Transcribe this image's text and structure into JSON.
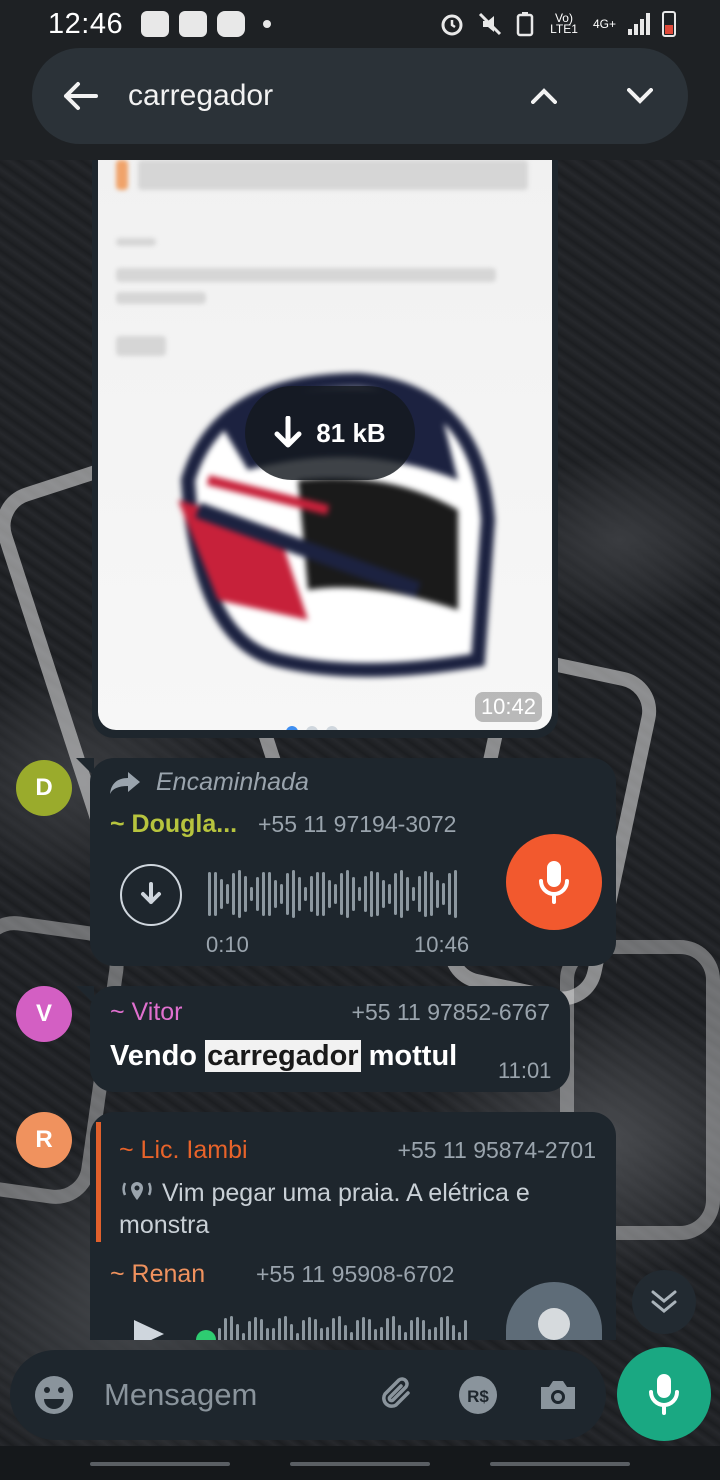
{
  "status_bar": {
    "time": "12:46",
    "network_label": "Vo) LTE1",
    "network_type": "4G+",
    "icons": [
      "twitch-icon",
      "twitch-icon",
      "youtube-icon",
      "alarm-icon",
      "mute-icon",
      "battery-saver-icon",
      "signal-icon",
      "battery-icon"
    ]
  },
  "search": {
    "query": "carregador"
  },
  "photo_message": {
    "download_size": "81 kB",
    "time": "10:42"
  },
  "messages": [
    {
      "avatar_letter": "D",
      "avatar_color": "#9aab2c",
      "forwarded_label": "Encaminhada",
      "sender": "~ Dougla...",
      "sender_color": "#b7c43e",
      "phone": "+55 11 97194-3072",
      "voice_duration": "0:10",
      "time": "10:46"
    },
    {
      "avatar_letter": "V",
      "avatar_color": "#d35fc3",
      "sender": "~ Vitor",
      "sender_color": "#e070cf",
      "phone": "+55 11 97852-6767",
      "text_before": "Vendo ",
      "text_highlight": "carregador",
      "text_after": " mottul",
      "time": "11:01"
    },
    {
      "avatar_letter": "R",
      "avatar_color": "#f0925e",
      "quote_sender": "~ Lic. Iambi",
      "quote_sender_color": "#e8632a",
      "quote_phone": "+55 11 95874-2701",
      "quote_text": "Vim pegar uma praia. A elétrica e monstra",
      "sender": "~ Renan",
      "sender_color": "#f0925e",
      "phone": "+55 11 95908-6702"
    }
  ],
  "input": {
    "placeholder": "Mensagem"
  },
  "colors": {
    "accent_orange": "#f2592e",
    "send_green": "#1aa882",
    "bubble_bg": "#1e262d"
  }
}
